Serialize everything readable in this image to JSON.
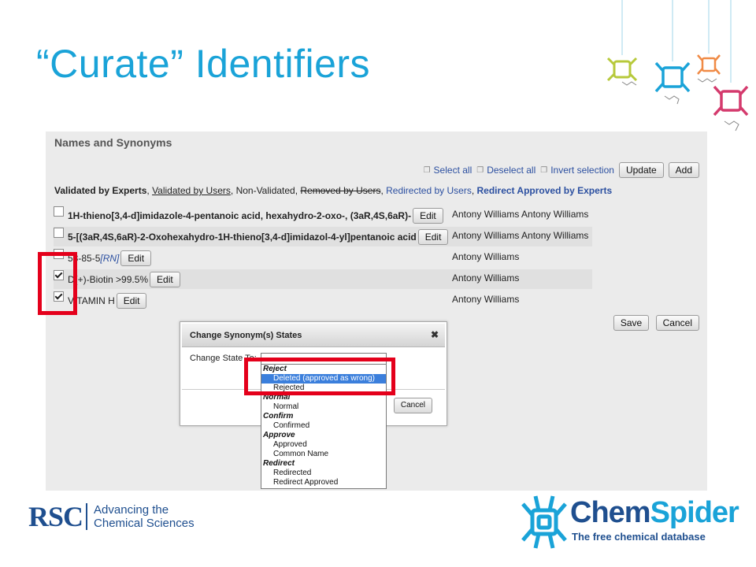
{
  "slide": {
    "title": "“Curate” Identifiers"
  },
  "panel": {
    "title": "Names and Synonyms",
    "toolbar": {
      "select_all": "Select all",
      "deselect_all": "Deselect all",
      "invert_selection": "Invert selection",
      "update_label": "Update",
      "add_label": "Add"
    },
    "legend": {
      "validated_experts": "Validated by Experts",
      "validated_users": "Validated by Users",
      "non_validated": "Non-Validated",
      "removed_users": "Removed by Users",
      "redirected_users": "Redirected by Users",
      "redirect_approved": "Redirect Approved by Experts"
    },
    "rows": [
      {
        "checked": false,
        "name": "1H-thieno[3,4-d]imidazole-4-pentanoic acid, hexahydro-2-oxo-, (3aR,4S,6aR)-",
        "edit": "Edit",
        "users": "Antony Williams Antony Williams"
      },
      {
        "checked": false,
        "name": "5-[(3aR,4S,6aR)-2-Oxohexahydro-1H-thieno[3,4-d]imidazol-4-yl]pentanoic acid",
        "edit": "Edit",
        "users": "Antony Williams Antony Williams"
      },
      {
        "checked": false,
        "name": "58-85-5",
        "tag": "[RN]",
        "edit": "Edit",
        "users": "Antony Williams"
      },
      {
        "checked": true,
        "name": "D(+)-Biotin >99.5%",
        "edit": "Edit",
        "users": "Antony Williams"
      },
      {
        "checked": true,
        "name": "VITAMIN H",
        "edit": "Edit",
        "users": "Antony Williams"
      }
    ],
    "save_label": "Save",
    "cancel_label": "Cancel"
  },
  "dialog": {
    "title": "Change Synonym(s) States",
    "close_glyph": "✖",
    "label": "Change State To:",
    "cancel_label": "Cancel"
  },
  "dropdown": {
    "groups": [
      {
        "label": "Reject",
        "options": [
          "Deleted (approved as wrong)",
          "Rejected"
        ]
      },
      {
        "label": "Normal",
        "options": [
          "Normal"
        ]
      },
      {
        "label": "Confirm",
        "options": [
          "Confirmed"
        ]
      },
      {
        "label": "Approve",
        "options": [
          "Approved",
          "Common Name"
        ]
      },
      {
        "label": "Redirect",
        "options": [
          "Redirected",
          "Redirect Approved"
        ]
      }
    ],
    "selected": "Deleted (approved as wrong)"
  },
  "footer": {
    "rsc_mark": "RSC",
    "rsc_line1": "Advancing the",
    "rsc_line2": "Chemical Sciences",
    "cs_part1": "Chem",
    "cs_part2": "Spider",
    "cs_tagline": "The free chemical database"
  },
  "colors": {
    "title": "#1aa3d8",
    "highlight": "#e4001b",
    "link": "#2b4fa0",
    "brand": "#1f4f8f"
  }
}
